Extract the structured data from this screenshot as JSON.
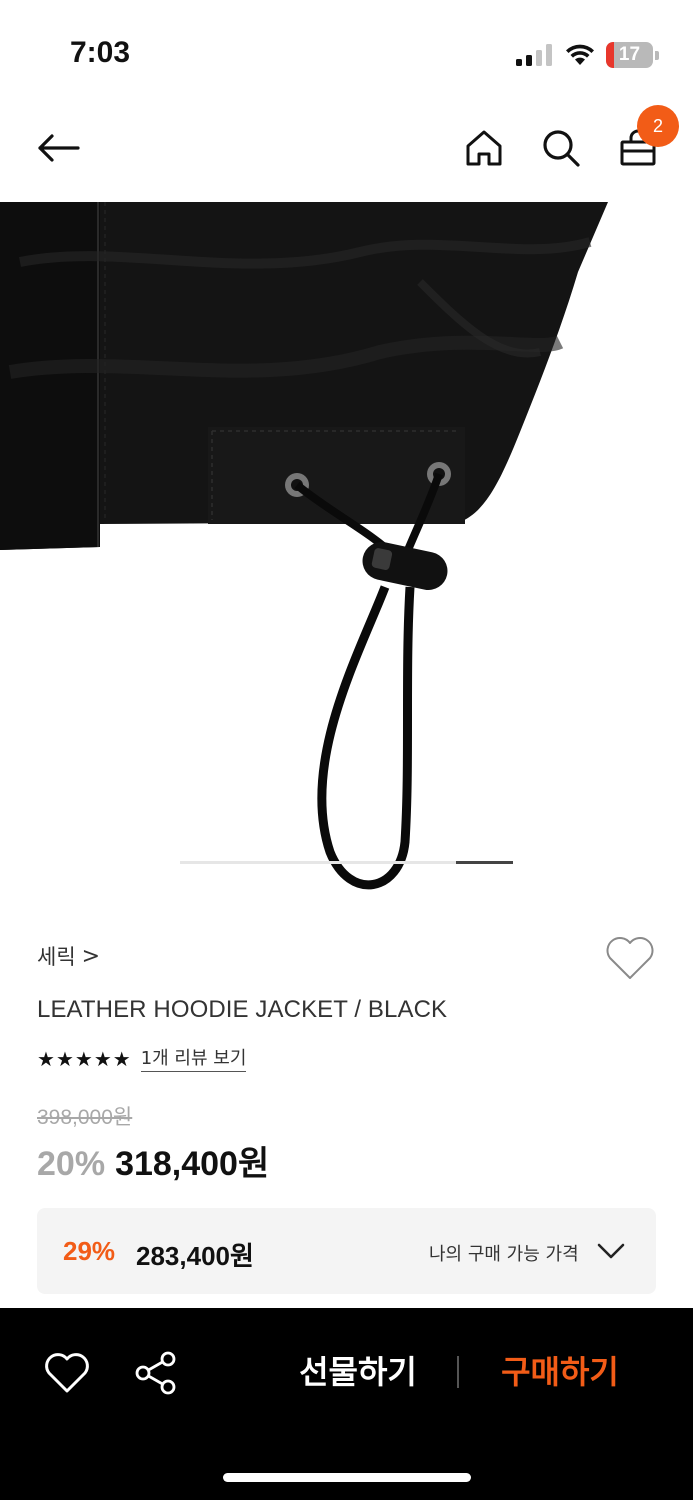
{
  "status_bar": {
    "time": "7:03",
    "battery_level": "17",
    "battery_fraction": 0.17
  },
  "header": {
    "cart_count": "2",
    "icons": [
      "back-arrow-icon",
      "home-icon",
      "search-icon",
      "shopping-bag-icon"
    ]
  },
  "gallery": {
    "active_slide_fraction_start": 0.83,
    "active_slide_fraction_end": 1.0
  },
  "product": {
    "brand": "세릭",
    "brand_chevron": ">",
    "name": "LEATHER HOODIE JACKET / BLACK",
    "rating_stars": 5,
    "review_link": "1개 리뷰 보기",
    "original_price": "398,000원",
    "discount_rate": "20%",
    "sale_price": "318,400원"
  },
  "my_price": {
    "discount_rate": "29%",
    "price": "283,400원",
    "label": "나의 구매 가능 가격"
  },
  "bottom_bar": {
    "gift_label": "선물하기",
    "buy_label": "구매하기"
  },
  "colors": {
    "accent": "#f25c17",
    "battery_low": "#e8372c"
  }
}
